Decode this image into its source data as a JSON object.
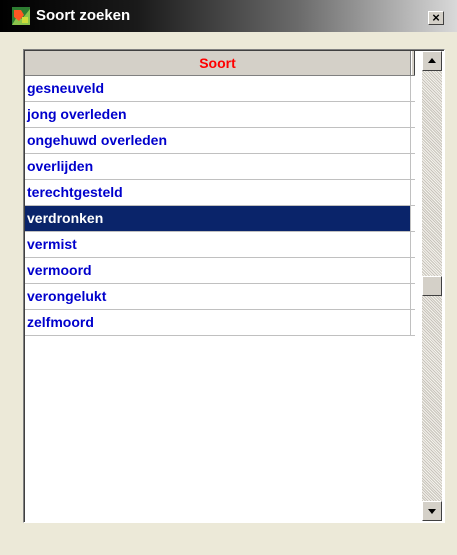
{
  "window": {
    "title": "Soort zoeken",
    "close_label": "×"
  },
  "grid": {
    "column_header": "Soort",
    "rows": [
      {
        "label": "gesneuveld"
      },
      {
        "label": "jong overleden"
      },
      {
        "label": "ongehuwd overleden"
      },
      {
        "label": "overlijden"
      },
      {
        "label": "terechtgesteld"
      },
      {
        "label": "verdronken",
        "selected": true
      },
      {
        "label": "vermist"
      },
      {
        "label": "vermoord"
      },
      {
        "label": "verongelukt"
      },
      {
        "label": "zelfmoord"
      }
    ],
    "scroll_position": 0.5
  },
  "colors": {
    "header_text": "#ff0000",
    "row_text": "#0000cc",
    "selection_bg": "#0a246a"
  },
  "icons": {
    "app": "app-icon",
    "close": "close-icon",
    "scroll_up": "scroll-up-arrow-icon",
    "scroll_down": "scroll-down-arrow-icon"
  }
}
